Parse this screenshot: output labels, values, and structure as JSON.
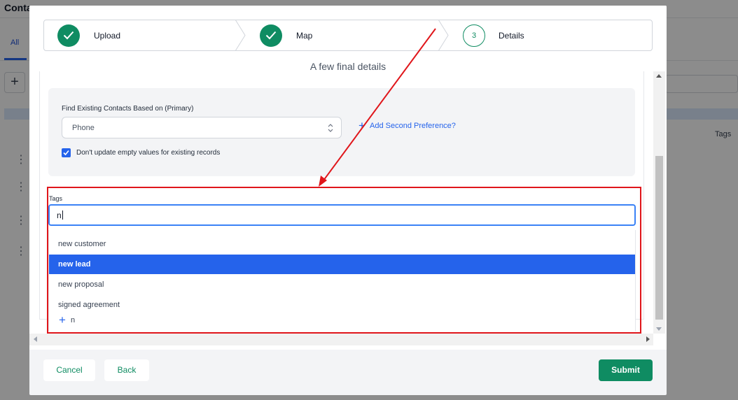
{
  "background": {
    "title": "Conta",
    "tab_all": "All",
    "plus": "+",
    "col_tags": "Tags",
    "row_dots": "⋮"
  },
  "stepper": {
    "steps": [
      {
        "label": "Upload",
        "state": "done"
      },
      {
        "label": "Map",
        "state": "done"
      },
      {
        "label": "Details",
        "state": "current",
        "number": "3"
      }
    ]
  },
  "section_title": "A few final details",
  "preferences": {
    "label": "Find Existing Contacts Based on (Primary)",
    "selected": "Phone",
    "add_second": "Add Second Preference?",
    "checkbox_checked": true,
    "checkbox_label": "Don't update empty values for existing records"
  },
  "tags": {
    "label": "Tags",
    "input_value": "n",
    "options": [
      "new customer",
      "new lead",
      "new proposal",
      "signed agreement"
    ],
    "highlighted_index": 1,
    "add_option": "n"
  },
  "footer": {
    "cancel": "Cancel",
    "back": "Back",
    "submit": "Submit"
  },
  "colors": {
    "primary_green": "#0f8c62",
    "accent_blue": "#2563eb",
    "annotation_red": "#e0161b"
  }
}
